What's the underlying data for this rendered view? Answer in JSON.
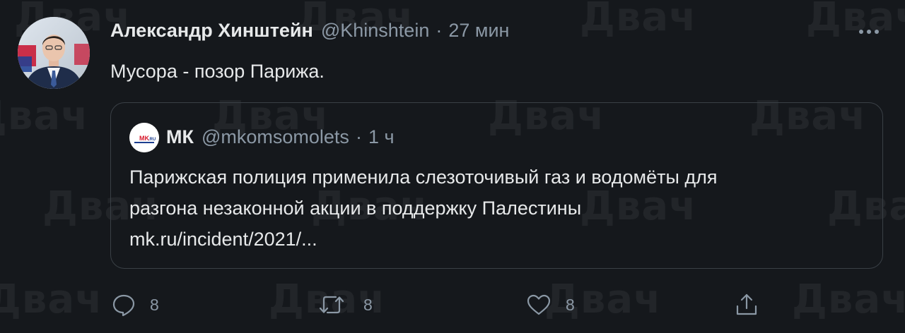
{
  "tweet": {
    "author_name": "Александр Хинштейн",
    "author_handle": "@Khinshtein",
    "separator": "·",
    "time": "27 мин",
    "text": "Мусора - позор Парижа."
  },
  "quote": {
    "avatar_label": "MK.RU",
    "name": "МК",
    "handle": "@mkomsomolets",
    "separator": "·",
    "time": "1 ч",
    "lines": [
      "Парижская полиция применила слезоточивый газ и водомёты для",
      "разгона незаконной акции в поддержку Палестины",
      "mk.ru/incident/2021/..."
    ]
  },
  "actions": {
    "reply_count": "8",
    "retweet_count": "8",
    "like_count": "8"
  },
  "icons": {
    "reply": "reply-icon",
    "retweet": "retweet-icon",
    "like": "heart-icon",
    "share": "share-icon",
    "more": "more-options-icon"
  },
  "colors": {
    "background": "#15181c",
    "text_primary": "#e7e9ea",
    "text_secondary": "#8b98a5",
    "border": "#3a4046"
  },
  "watermark": "Двач"
}
